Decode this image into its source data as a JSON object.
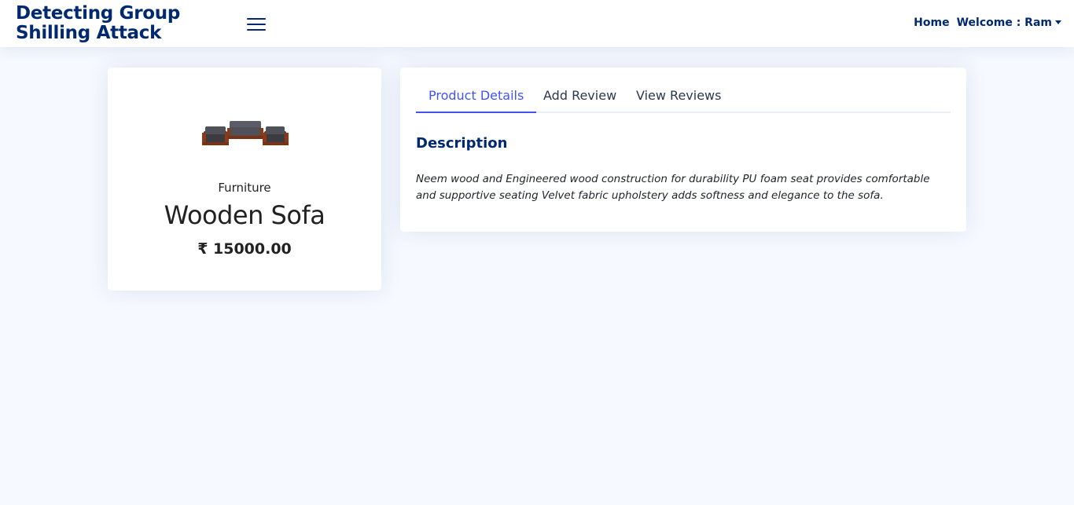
{
  "header": {
    "logo_line1": "Detecting Group",
    "logo_line2": "Shilling Attack",
    "menu_icon": "hamburger-menu-icon",
    "nav_home": "Home",
    "nav_user": "Welcome : Ram",
    "brand_color": "#012970",
    "accent_color": "#4154f1"
  },
  "product": {
    "image_icon": "wooden-sofa-set-image",
    "category": "Furniture",
    "name": "Wooden Sofa",
    "price": "₹ 15000.00"
  },
  "tabs": [
    {
      "label": "Product Details",
      "active": true
    },
    {
      "label": "Add Review",
      "active": false
    },
    {
      "label": "View Reviews",
      "active": false
    }
  ],
  "details": {
    "heading": "Description",
    "description": "Neem wood and Engineered wood construction for durability PU foam seat provides comfortable and supportive seating Velvet fabric upholstery adds softness and elegance to the sofa."
  }
}
